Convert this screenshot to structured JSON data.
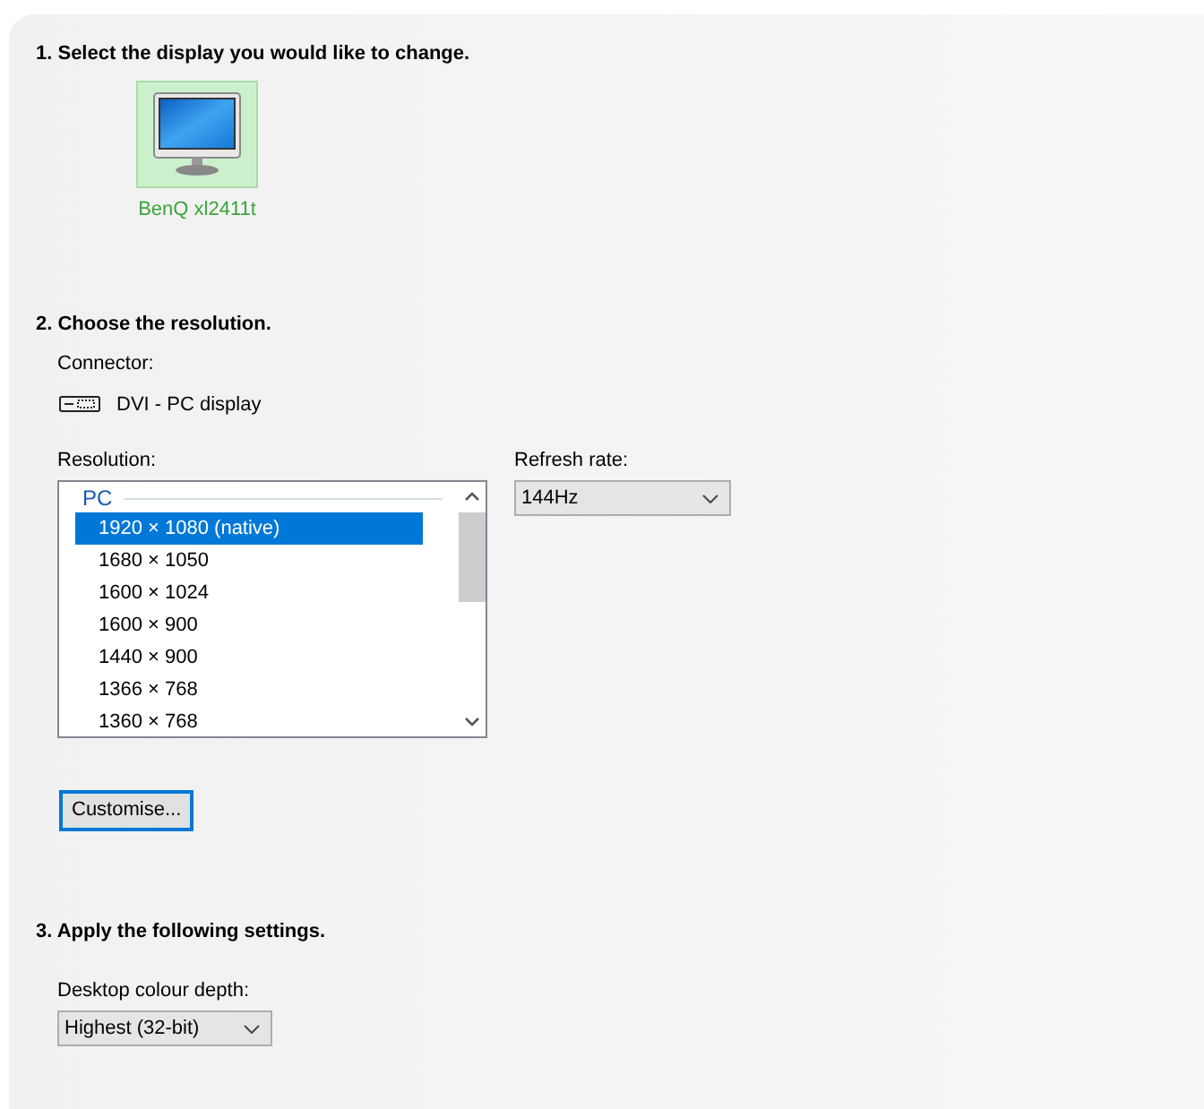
{
  "section_1": {
    "heading": "1. Select the display you would like to change.",
    "displays": [
      {
        "label": "BenQ xl2411t",
        "selected": true
      }
    ]
  },
  "section_2": {
    "heading": "2. Choose the resolution.",
    "connector_label": "Connector:",
    "connector": "DVI - PC display",
    "resolution_label": "Resolution:",
    "resolution_group": "PC",
    "resolutions": [
      {
        "label": "1920 × 1080 (native)",
        "selected": true
      },
      {
        "label": "1680 × 1050",
        "selected": false
      },
      {
        "label": "1600 × 1024",
        "selected": false
      },
      {
        "label": "1600 × 900",
        "selected": false
      },
      {
        "label": "1440 × 900",
        "selected": false
      },
      {
        "label": "1366 × 768",
        "selected": false
      },
      {
        "label": "1360 × 768",
        "selected": false
      }
    ],
    "refresh_rate_label": "Refresh rate:",
    "refresh_rate": "144Hz",
    "customise_button": "Customise..."
  },
  "section_3": {
    "heading": "3. Apply the following settings.",
    "colour_depth_label": "Desktop colour depth:",
    "colour_depth": "Highest (32-bit)"
  }
}
